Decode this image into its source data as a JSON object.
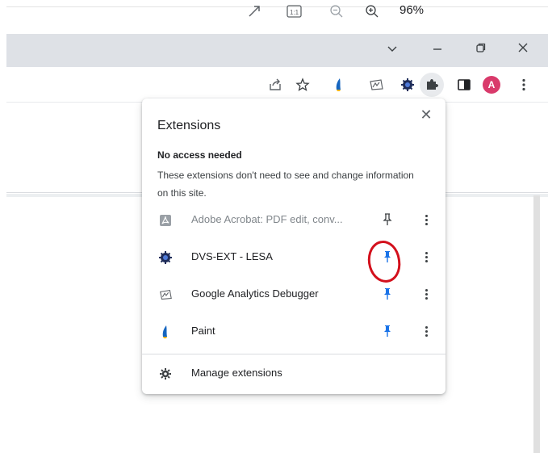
{
  "zoom_bar": {
    "expand_icon": "expand-icon",
    "actual_size_label": "1:1",
    "zoom_out_icon": "zoom-out-icon",
    "zoom_in_icon": "zoom-in-icon",
    "zoom_percent": "96%"
  },
  "window_controls": {
    "tab_search": "⌄",
    "minimize": "—",
    "restore": "⧉",
    "close": "✕"
  },
  "toolbar": {
    "profile_initial": "A",
    "accent_color": "#1a73e8",
    "avatar_color": "#d93a6b"
  },
  "extensions_popup": {
    "title": "Extensions",
    "close_label": "✕",
    "section_title": "No access needed",
    "section_description": "These extensions don't need to see and change information on this site.",
    "items": [
      {
        "name": "Adobe Acrobat: PDF edit, conv...",
        "icon": "adobe-acrobat-icon",
        "pinned": false,
        "dimmed": true
      },
      {
        "name": "DVS-EXT - LESA",
        "icon": "dvs-ext-icon",
        "pinned": true,
        "dimmed": false
      },
      {
        "name": "Google Analytics Debugger",
        "icon": "google-analytics-debugger-icon",
        "pinned": true,
        "dimmed": false
      },
      {
        "name": "Paint",
        "icon": "paint-icon",
        "pinned": true,
        "dimmed": false
      }
    ],
    "manage_label": "Manage extensions"
  },
  "annotation": {
    "highlight": "red-circle-around-pin",
    "color": "#d3101c"
  }
}
